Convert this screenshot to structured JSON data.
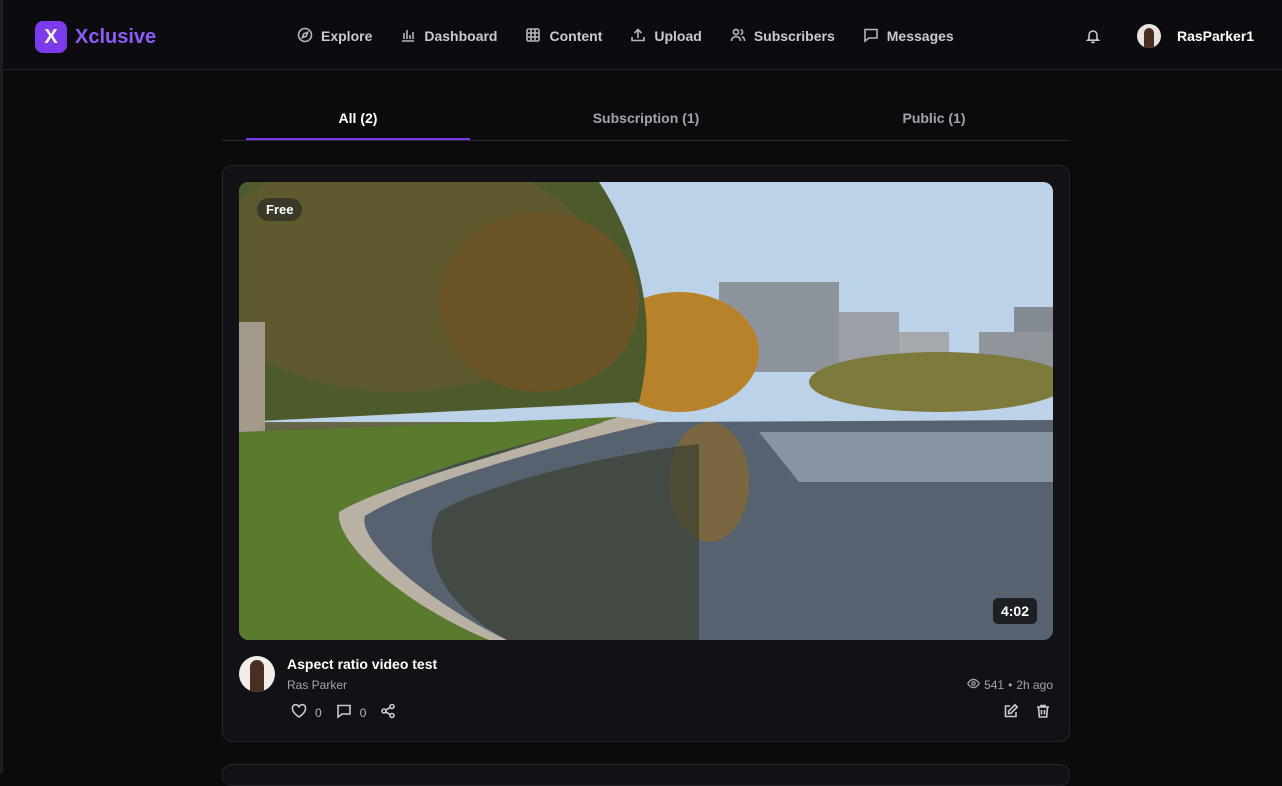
{
  "app": {
    "logo_letter": "X",
    "name": "Xclusive",
    "accent": "#7c3aed"
  },
  "nav": [
    {
      "label": "Explore",
      "icon": "compass-icon"
    },
    {
      "label": "Dashboard",
      "icon": "bar-chart-icon"
    },
    {
      "label": "Content",
      "icon": "grid-icon"
    },
    {
      "label": "Upload",
      "icon": "upload-icon"
    },
    {
      "label": "Subscribers",
      "icon": "users-icon"
    },
    {
      "label": "Messages",
      "icon": "message-icon"
    }
  ],
  "header": {
    "notifications_icon": "bell-icon",
    "username": "RasParker1"
  },
  "tabs": [
    {
      "label": "All (2)",
      "active": true
    },
    {
      "label": "Subscription (1)",
      "active": false
    },
    {
      "label": "Public (1)",
      "active": false
    }
  ],
  "post": {
    "badge": "Free",
    "duration": "4:02",
    "title": "Aspect ratio video test",
    "author": "Ras Parker",
    "views": "541",
    "separator": "•",
    "posted": "2h ago",
    "likes": "0",
    "comments": "0"
  }
}
